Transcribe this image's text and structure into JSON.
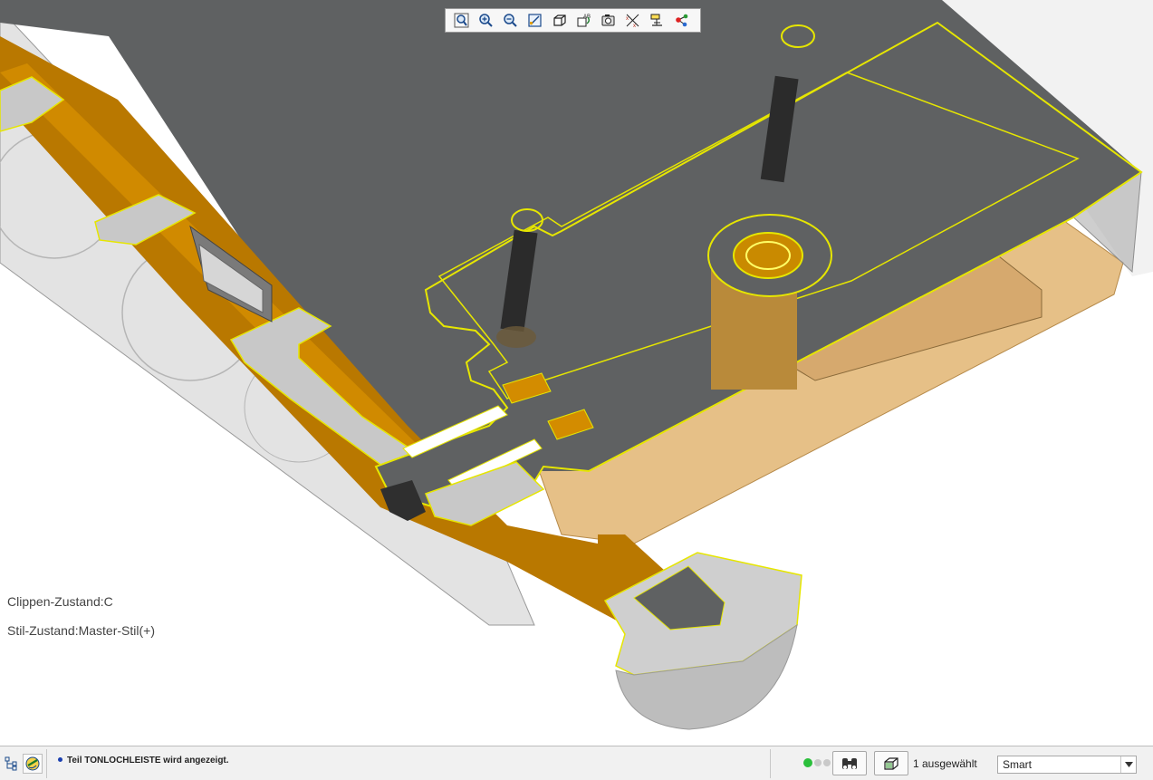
{
  "toolbar": {
    "buttons": [
      {
        "icon": "zoom-fit-icon",
        "label": "Neu einpassen"
      },
      {
        "icon": "zoom-in-icon",
        "label": "Vergrößern"
      },
      {
        "icon": "zoom-out-icon",
        "label": "Verkleinern"
      },
      {
        "icon": "repaint-icon",
        "label": "Neu zeichnen"
      },
      {
        "icon": "display-style-icon",
        "label": "Darstellungsstil"
      },
      {
        "icon": "saved-orientations-icon",
        "label": "Gespeicherte Orientierungen"
      },
      {
        "icon": "view-manager-icon",
        "label": "Ansichtsmanager"
      },
      {
        "icon": "datum-display-icon",
        "label": "Bezugsanzeige"
      },
      {
        "icon": "annotation-display-icon",
        "label": "Anmerkungsanzeige"
      },
      {
        "icon": "spin-center-icon",
        "label": "Drehzentrum"
      }
    ]
  },
  "viewport": {
    "clip_state": "Clippen-Zustand:C",
    "style_state": "Stil-Zustand:Master-Stil(+)",
    "colors": {
      "section_face": "#5f6162",
      "section_edge": "#ffff00",
      "orange_part": "#b97800",
      "tan_part": "#e2b572",
      "transparent_shell": "#c9c9c9"
    }
  },
  "status_bar": {
    "message": "Teil TONLOCHLEISTE wird angezeigt.",
    "selection_count": "1 ausgewählt",
    "filter_value": "Smart",
    "icons": [
      "model-tree-icon",
      "regenerate-icon",
      "find-binoculars-icon",
      "selection-box-icon"
    ]
  }
}
